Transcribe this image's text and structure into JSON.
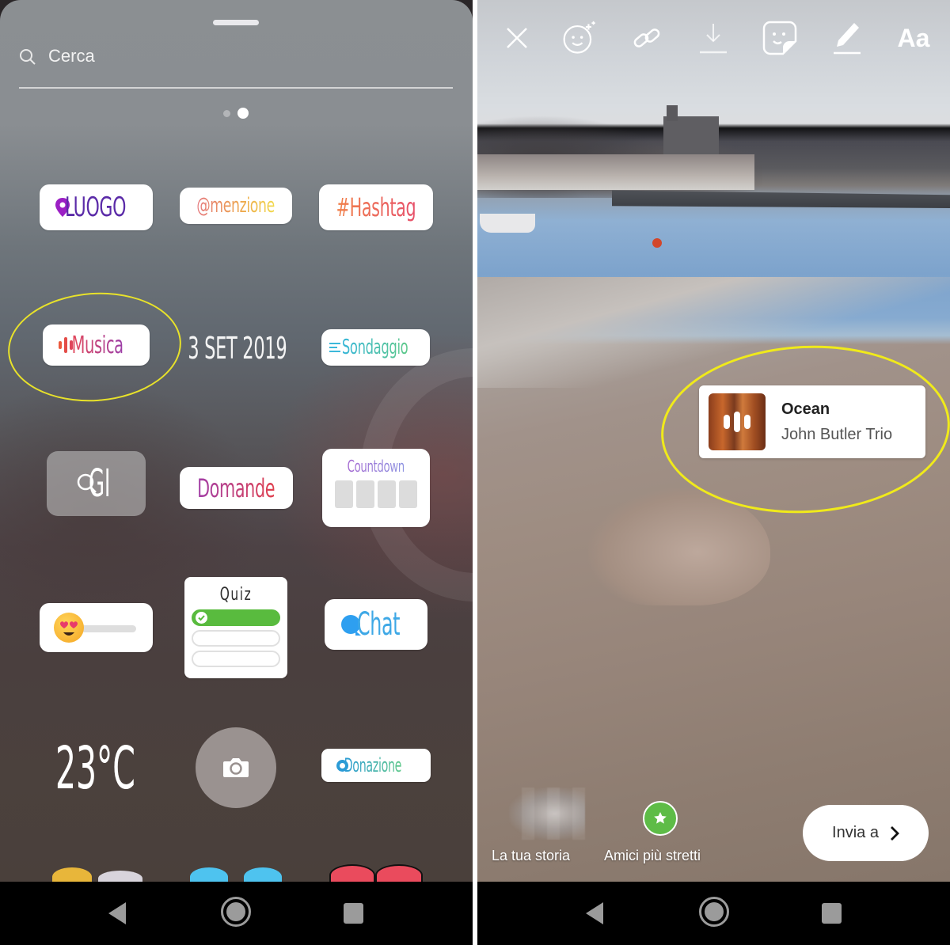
{
  "left_screen": {
    "search": {
      "placeholder": "Cerca",
      "icon": "search-icon"
    },
    "pager": {
      "pages": 2,
      "active_page": 2
    },
    "stickers": {
      "luogo": {
        "label": "LUOGO",
        "icon": "location-pin-icon",
        "color": "#5b2ba8"
      },
      "menzione": {
        "label": "@menzione"
      },
      "hashtag": {
        "label": "#Hashtag"
      },
      "musica": {
        "label": "Musica",
        "icon": "music-bars-icon",
        "highlighted": true
      },
      "date": {
        "label": "3 SET 2019"
      },
      "sondaggio": {
        "label": "Sondaggio",
        "icon": "poll-lines-icon"
      },
      "gif": {
        "label": "GI",
        "icon": "search-icon"
      },
      "domande": {
        "label": "Domande"
      },
      "countdown": {
        "label": "Countdown",
        "cells": 4
      },
      "slider": {
        "emoji": "😍",
        "icon": "heart-eyes-emoji-icon"
      },
      "quiz": {
        "label": "Quiz",
        "options": 3,
        "correct_option": 1
      },
      "chat": {
        "label": "Chat",
        "icon": "chat-bubble-icon"
      },
      "temperature": {
        "label": "23°C"
      },
      "camera": {
        "icon": "camera-icon"
      },
      "donazione": {
        "label": "Donazione",
        "icon": "heart-icon"
      }
    },
    "highlight_color": "#e8e22a"
  },
  "right_screen": {
    "toolbar": {
      "close": "close-icon",
      "effects": "face-effects-icon",
      "link": "link-icon",
      "download": "download-icon",
      "sticker": "sticker-icon",
      "draw": "pen-icon",
      "text_label": "Aa"
    },
    "music_sticker": {
      "title": "Ocean",
      "artist": "John Butler Trio",
      "highlighted": true
    },
    "share": {
      "your_story_label": "La tua storia",
      "close_friends_label": "Amici più stretti",
      "send_label": "Invia a",
      "close_friends_color": "#5ebc47"
    }
  },
  "navbar": {
    "back": "back-icon",
    "home": "home-icon",
    "recents": "recents-icon"
  }
}
